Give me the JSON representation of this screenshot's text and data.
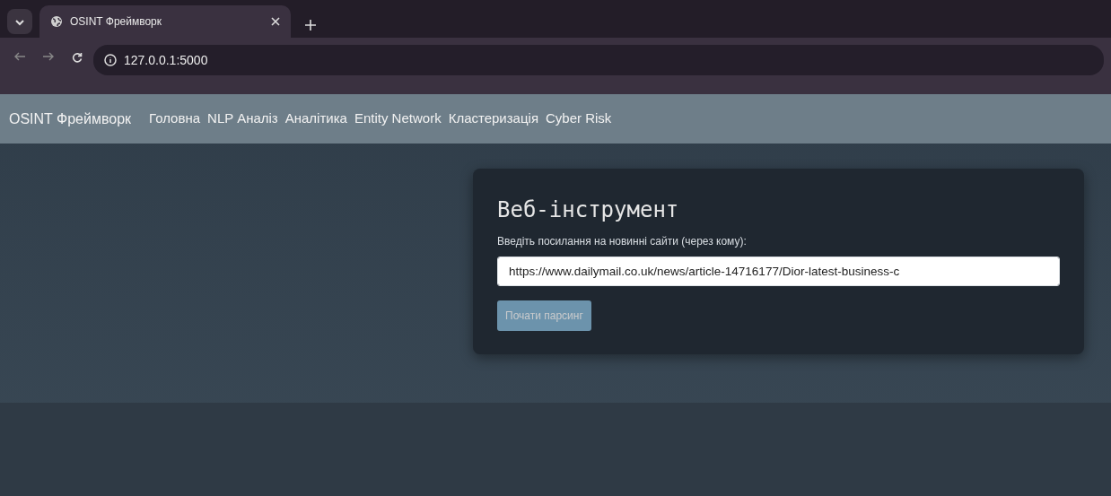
{
  "browser": {
    "tab_title": "OSINT Фреймворк",
    "address": "127.0.0.1:5000"
  },
  "navbar": {
    "brand": "OSINT Фреймворк",
    "links": [
      {
        "label": "Головна"
      },
      {
        "label": "NLP Аналіз"
      },
      {
        "label": "Аналітика"
      },
      {
        "label": "Entity Network"
      },
      {
        "label": "Кластеризація"
      },
      {
        "label": "Cyber Risk"
      }
    ]
  },
  "card": {
    "title": "Веб-інструмент",
    "label": "Введіть посилання на новинні сайти (через кому):",
    "input_value": "https://www.dailymail.co.uk/news/article-14716177/Dior-latest-business-c",
    "button": {
      "label": "Почати парсинг",
      "disabled": true
    }
  }
}
